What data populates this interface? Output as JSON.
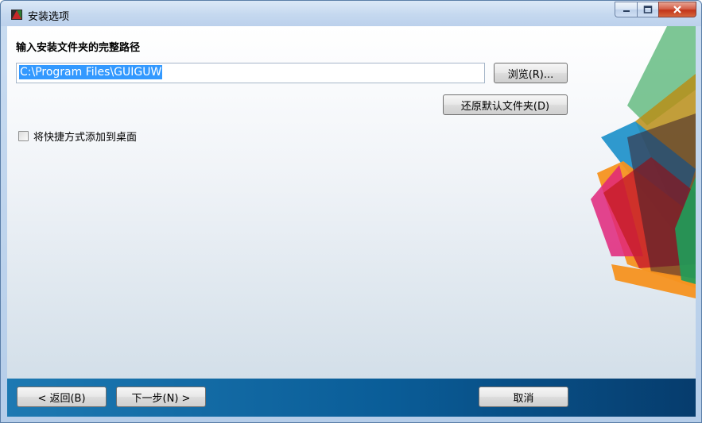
{
  "window": {
    "title": "安装选项",
    "controls": {
      "minimize_icon": "minimize-icon",
      "maximize_icon": "maximize-icon",
      "close_icon": "close-icon"
    }
  },
  "main": {
    "heading": "输入安装文件夹的完整路径",
    "path_value": "C:\\Program Files\\GUIGUW",
    "browse_label": "浏览(R)...",
    "restore_label": "还原默认文件夹(D)",
    "desktop_shortcut_label": "将快捷方式添加到桌面",
    "desktop_shortcut_checked": false
  },
  "footer": {
    "back_label": "< 返回(B)",
    "next_label": "下一步(N) >",
    "cancel_label": "取消"
  },
  "colors": {
    "footer_bar": "#0a5d98",
    "selection": "#3399ff"
  }
}
